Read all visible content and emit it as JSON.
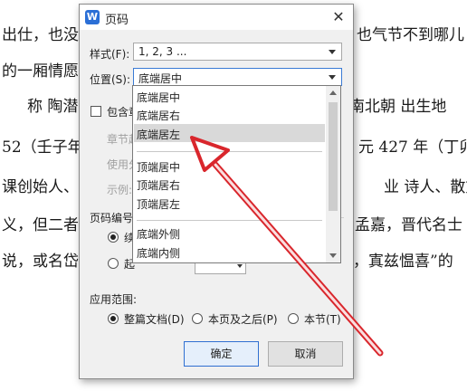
{
  "background_doc": {
    "lines": [
      "出仕，也没见",
      "也气节不到哪儿",
      "的一厢情愿。",
      "称  陶潜",
      "南北朝  出生地",
      "52（壬子年",
      "元 427 年（丁卯",
      "课创始人、文",
      "业  诗人、散文",
      "义，但二者m",
      "孟嘉，晋代名士",
      "说，或名岱或",
      "，寘兹愠喜”的"
    ]
  },
  "dialog": {
    "title": "页码",
    "app_icon_glyph": "W",
    "close_glyph": "✕",
    "style_label": "样式(F):",
    "style_value": "1, 2, 3 ...",
    "position_label": "位置(S):",
    "position_value": "底端居中",
    "include_label": "包含章",
    "chapter_label": "章节起",
    "use_label": "使用分",
    "example_label": "示例:",
    "page_numbering_label": "页码编号",
    "continue_label": "续",
    "start_label": "起",
    "apply_range_label": "应用范围:",
    "apply_options": [
      "整篇文档(D)",
      "本页及之后(P)",
      "本节(T)"
    ],
    "ok_label": "确定",
    "cancel_label": "取消"
  },
  "dropdown": {
    "items": [
      "底端居中",
      "底端居右",
      "底端居左",
      "顶端居中",
      "顶端居右",
      "顶端居左",
      "底端外侧",
      "底端内侧"
    ],
    "highlighted_index": 2
  },
  "colors": {
    "arrow": "#d9262c",
    "accent": "#2f6fd1"
  }
}
